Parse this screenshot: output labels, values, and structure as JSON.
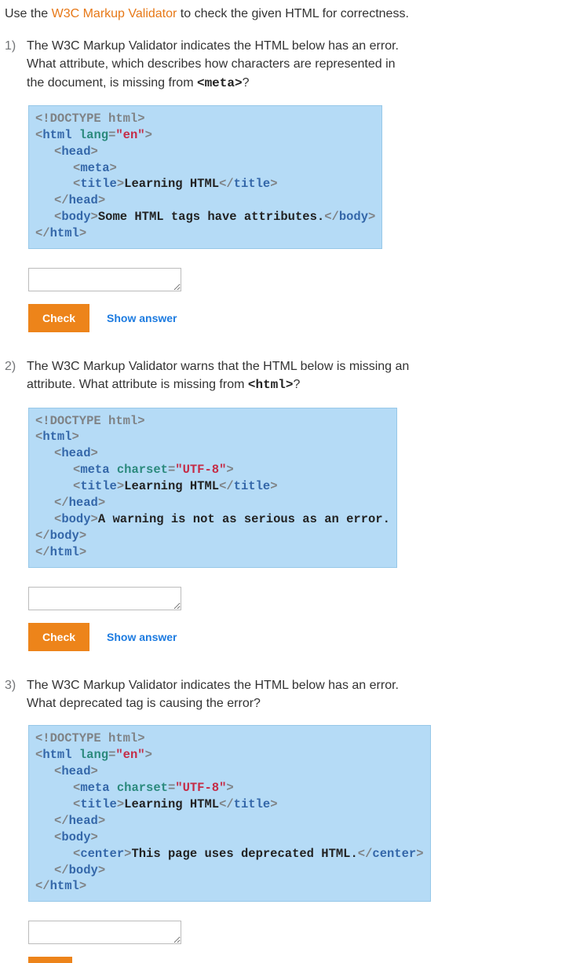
{
  "intro": {
    "prefix": "Use the ",
    "link": "W3C Markup Validator",
    "suffix": " to check the given HTML for correctness."
  },
  "common": {
    "check_label": "Check",
    "show_answer_label": "Show answer"
  },
  "questions": [
    {
      "number": "1)",
      "text_line1": "The W3C Markup Validator indicates the HTML below has an error.",
      "text_line2a": "What attribute, which describes how characters are represented in",
      "text_line2b": "the document, is missing from ",
      "code_frag": "<meta>",
      "text_line2c": "?",
      "code": {
        "l0a": "<!DOCTYPE html>",
        "l1_open": "<",
        "l1_tag": "html",
        "l1_sp": " ",
        "l1_attr": "lang",
        "l1_eq": "=",
        "l1_val": "\"en\"",
        "l1_close": ">",
        "l2_open": "<",
        "l2_tag": "head",
        "l2_close": ">",
        "l3_open": "<",
        "l3_tag": "meta",
        "l3_close": ">",
        "l4_open": "<",
        "l4_tag": "title",
        "l4_close": ">",
        "l4_text": "Learning HTML",
        "l4_open2": "</",
        "l4_close2": ">",
        "l5_open": "</",
        "l5_tag": "head",
        "l5_close": ">",
        "l6_open": "<",
        "l6_tag": "body",
        "l6_close": ">",
        "l6_text": "Some HTML tags have attributes.",
        "l6_open2": "</",
        "l6_close2": ">",
        "l7_open": "</",
        "l7_tag": "html",
        "l7_close": ">"
      }
    },
    {
      "number": "2)",
      "text_line1": "The W3C Markup Validator warns that the HTML below is missing an",
      "text_line2a": "attribute. What attribute is missing from ",
      "code_frag": "<html>",
      "text_line2c": "?",
      "code": {
        "l0a": "<!DOCTYPE html>",
        "l1_open": "<",
        "l1_tag": "html",
        "l1_close": ">",
        "l2_open": "<",
        "l2_tag": "head",
        "l2_close": ">",
        "l3_open": "<",
        "l3_tag": "meta",
        "l3_sp": " ",
        "l3_attr": "charset",
        "l3_eq": "=",
        "l3_val": "\"UTF-8\"",
        "l3_close": ">",
        "l4_open": "<",
        "l4_tag": "title",
        "l4_close": ">",
        "l4_text": "Learning HTML",
        "l4_open2": "</",
        "l4_close2": ">",
        "l5_open": "</",
        "l5_tag": "head",
        "l5_close": ">",
        "l6_open": "<",
        "l6_tag": "body",
        "l6_close": ">",
        "l6_text": "A warning is not as serious as an error.",
        "l7_open": "</",
        "l7_tag": "body",
        "l7_close": ">",
        "l8_open": "</",
        "l8_tag": "html",
        "l8_close": ">"
      }
    },
    {
      "number": "3)",
      "text_line1": "The W3C Markup Validator indicates the HTML below has an error.",
      "text_line2a": "What deprecated tag is causing the error?",
      "code": {
        "l0a": "<!DOCTYPE html>",
        "l1_open": "<",
        "l1_tag": "html",
        "l1_sp": " ",
        "l1_attr": "lang",
        "l1_eq": "=",
        "l1_val": "\"en\"",
        "l1_close": ">",
        "l2_open": "<",
        "l2_tag": "head",
        "l2_close": ">",
        "l3_open": "<",
        "l3_tag": "meta",
        "l3_sp": " ",
        "l3_attr": "charset",
        "l3_eq": "=",
        "l3_val": "\"UTF-8\"",
        "l3_close": ">",
        "l4_open": "<",
        "l4_tag": "title",
        "l4_close": ">",
        "l4_text": "Learning HTML",
        "l4_open2": "</",
        "l4_close2": ">",
        "l5_open": "</",
        "l5_tag": "head",
        "l5_close": ">",
        "l6_open": "<",
        "l6_tag": "body",
        "l6_close": ">",
        "l7_open": "<",
        "l7_tag": "center",
        "l7_close": ">",
        "l7_text": "This page uses deprecated HTML.",
        "l7_open2": "</",
        "l7_close2": ">",
        "l8_open": "</",
        "l8_tag": "body",
        "l8_close": ">",
        "l9_open": "</",
        "l9_tag": "html",
        "l9_close": ">"
      }
    }
  ]
}
